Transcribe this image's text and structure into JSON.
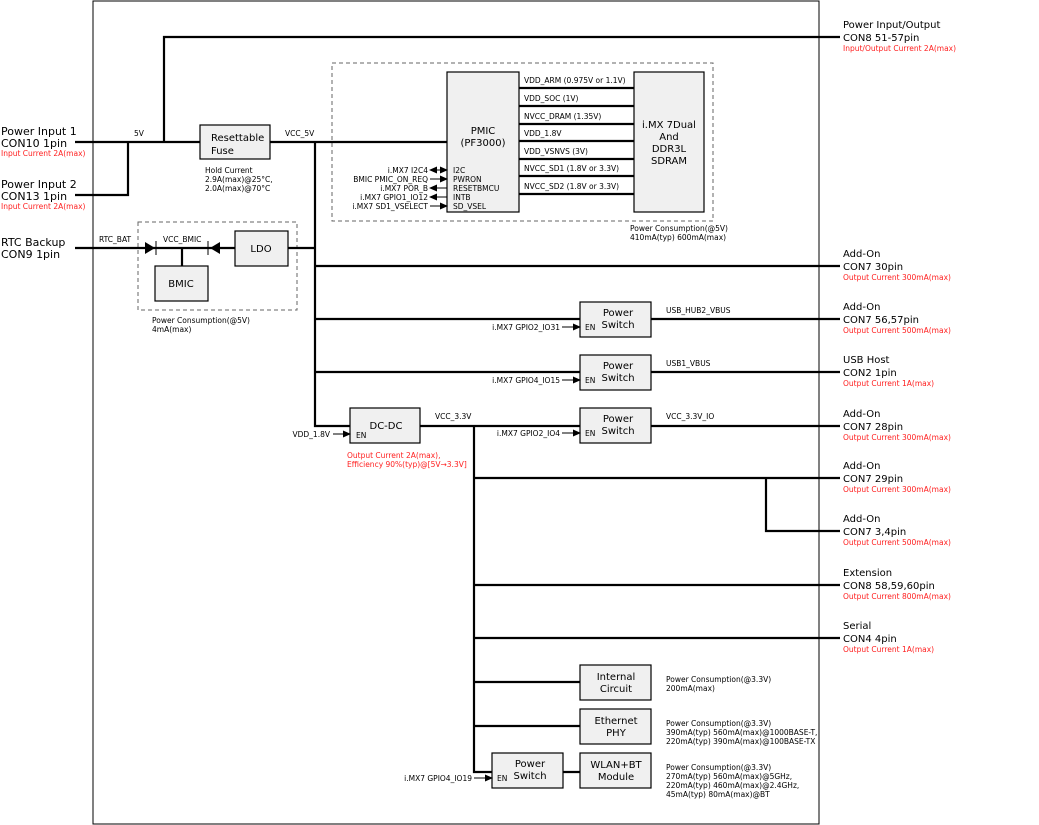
{
  "inputs": [
    {
      "title": "Power Input 1",
      "con": "CON10 1pin",
      "note": "Input Current 2A(max)"
    },
    {
      "title": "Power Input 2",
      "con": "CON13 1pin",
      "note": "Input Current 2A(max)"
    },
    {
      "title": "RTC Backup",
      "con": "CON9 1pin"
    }
  ],
  "nets": {
    "v5": "5V",
    "vcc5": "VCC_5V",
    "rtc": "RTC_BAT",
    "vbmic": "VCC_BMIC",
    "vcc33": "VCC_3.3V",
    "hub": "USB_HUB2_VBUS",
    "usb1": "USB1_VBUS",
    "io": "VCC_3.3V_IO",
    "vdd18": "VDD_1.8V"
  },
  "fuse": {
    "l1": "Resettable",
    "l2": "Fuse",
    "hold": [
      "Hold Current",
      "2.9A(max)@25°C,",
      "2.0A(max)@70°C"
    ]
  },
  "bmic": {
    "bmic": "BMIC",
    "ldo": "LDO",
    "power": [
      "Power Consumption(@5V)",
      "4mA(max)"
    ]
  },
  "pmic": {
    "l1": "PMIC",
    "l2": "(PF3000)",
    "pins": [
      "I2C",
      "PWRON",
      "RESETBMCU",
      "INTB",
      "SD_VSEL"
    ],
    "signals": [
      "i.MX7 I2C4",
      "BMIC PMIC_ON_REQ",
      "i.MX7 POR_B",
      "i.MX7 GPIO1_IO12",
      "i.MX7 SD1_VSELECT"
    ],
    "rails": [
      "VDD_ARM (0.975V or 1.1V)",
      "VDD_SOC (1V)",
      "NVCC_DRAM (1.35V)",
      "VDD_1.8V",
      "VDD_VSNVS (3V)",
      "NVCC_SD1 (1.8V or 3.3V)",
      "NVCC_SD2 (1.8V or 3.3V)"
    ],
    "power": [
      "Power Consumption(@5V)",
      "410mA(typ) 600mA(max)"
    ]
  },
  "imx": [
    "i.MX 7Dual",
    "And",
    "DDR3L",
    "SDRAM"
  ],
  "switch": {
    "l1": "Power",
    "l2": "Switch",
    "en": "EN",
    "gpio": [
      "i.MX7 GPIO2_IO31",
      "i.MX7 GPIO4_IO15",
      "i.MX7 GPIO2_IO4",
      "i.MX7 GPIO4_IO19"
    ]
  },
  "dcdc": {
    "label": "DC-DC",
    "en": "EN",
    "notes": [
      "Output Current 2A(max),",
      "Efficiency 90%(typ)@[5V→3.3V]"
    ]
  },
  "loads": [
    {
      "l1": "Internal",
      "l2": "Circuit",
      "power": [
        "Power Consumption(@3.3V)",
        "200mA(max)"
      ]
    },
    {
      "l1": "Ethernet",
      "l2": "PHY",
      "power": [
        "Power Consumption(@3.3V)",
        "390mA(typ) 560mA(max)@1000BASE-T,",
        "220mA(typ) 390mA(max)@100BASE-TX"
      ]
    },
    {
      "l1": "WLAN+BT",
      "l2": "Module",
      "power": [
        "Power Consumption(@3.3V)",
        "270mA(typ) 560mA(max)@5GHz,",
        "220mA(typ) 460mA(max)@2.4GHz,",
        "45mA(typ) 80mA(max)@BT"
      ]
    }
  ],
  "outputs": [
    {
      "title": "Power Input/Output",
      "con": "CON8 51-57pin",
      "note": "Input/Output Current 2A(max)"
    },
    {
      "title": "Add-On",
      "con": "CON7 30pin",
      "note": "Output Current 300mA(max)"
    },
    {
      "title": "Add-On",
      "con": "CON7 56,57pin",
      "note": "Output Current 500mA(max)"
    },
    {
      "title": "USB Host",
      "con": "CON2 1pin",
      "note": "Output Current 1A(max)"
    },
    {
      "title": "Add-On",
      "con": "CON7 28pin",
      "note": "Output Current 300mA(max)"
    },
    {
      "title": "Add-On",
      "con": "CON7 29pin",
      "note": "Output Current 300mA(max)"
    },
    {
      "title": "Add-On",
      "con": "CON7 3,4pin",
      "note": "Output Current 500mA(max)"
    },
    {
      "title": "Extension",
      "con": "CON8 58,59,60pin",
      "note": "Output Current 800mA(max)"
    },
    {
      "title": "Serial",
      "con": "CON4 4pin",
      "note": "Output Current 1A(max)"
    }
  ]
}
